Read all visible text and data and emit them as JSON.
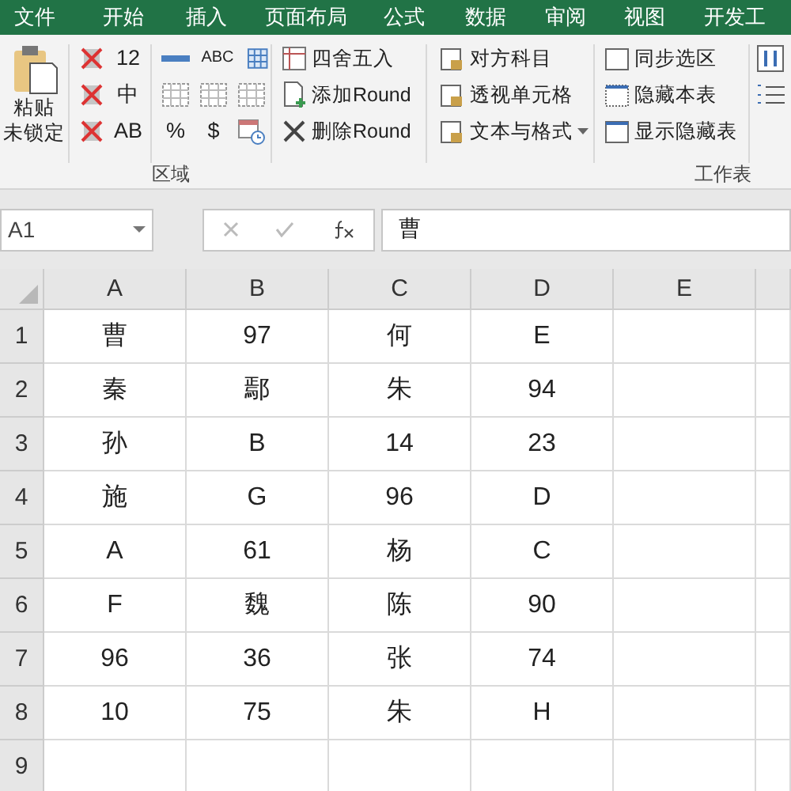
{
  "tabs": [
    {
      "label": "文件",
      "selected": false
    },
    {
      "label": "开始",
      "selected": false
    },
    {
      "label": "插入",
      "selected": false
    },
    {
      "label": "页面布局",
      "selected": false
    },
    {
      "label": "公式",
      "selected": false
    },
    {
      "label": "数据",
      "selected": false
    },
    {
      "label": "审阅",
      "selected": false
    },
    {
      "label": "视图",
      "selected": false
    },
    {
      "label": "开发工",
      "selected": false
    }
  ],
  "ribbon": {
    "paste_label": [
      "粘贴",
      "未锁定"
    ],
    "number_column": [
      "12",
      "中",
      "AB"
    ],
    "format_symbols": [
      "ABC",
      "%",
      "$"
    ],
    "round_buttons": [
      "四舍五入",
      "添加Round",
      "删除Round"
    ],
    "cell_buttons": [
      "对方科目",
      "透视单元格",
      "文本与格式"
    ],
    "sheet_buttons": [
      "同步选区",
      "隐藏本表",
      "显示隐藏表"
    ],
    "group_labels": [
      "区域",
      "工作表"
    ]
  },
  "formula_bar": {
    "name_box": "A1",
    "value": "曹"
  },
  "sheet": {
    "columns": [
      "A",
      "B",
      "C",
      "D",
      "E"
    ],
    "rows": [
      {
        "header": "1",
        "cells": [
          "曹",
          "97",
          "何",
          "E"
        ]
      },
      {
        "header": "2",
        "cells": [
          "秦",
          "鄢",
          "朱",
          "94"
        ]
      },
      {
        "header": "3",
        "cells": [
          "孙",
          "B",
          "14",
          "23"
        ]
      },
      {
        "header": "4",
        "cells": [
          "施",
          "G",
          "96",
          "D"
        ]
      },
      {
        "header": "5",
        "cells": [
          "A",
          "61",
          "杨",
          "C"
        ]
      },
      {
        "header": "6",
        "cells": [
          "F",
          "魏",
          "陈",
          "90"
        ]
      },
      {
        "header": "7",
        "cells": [
          "96",
          "36",
          "张",
          "74"
        ]
      },
      {
        "header": "8",
        "cells": [
          "10",
          "75",
          "朱",
          "H"
        ]
      },
      {
        "header": "9",
        "cells": [
          "",
          "",
          "",
          ""
        ]
      }
    ]
  }
}
